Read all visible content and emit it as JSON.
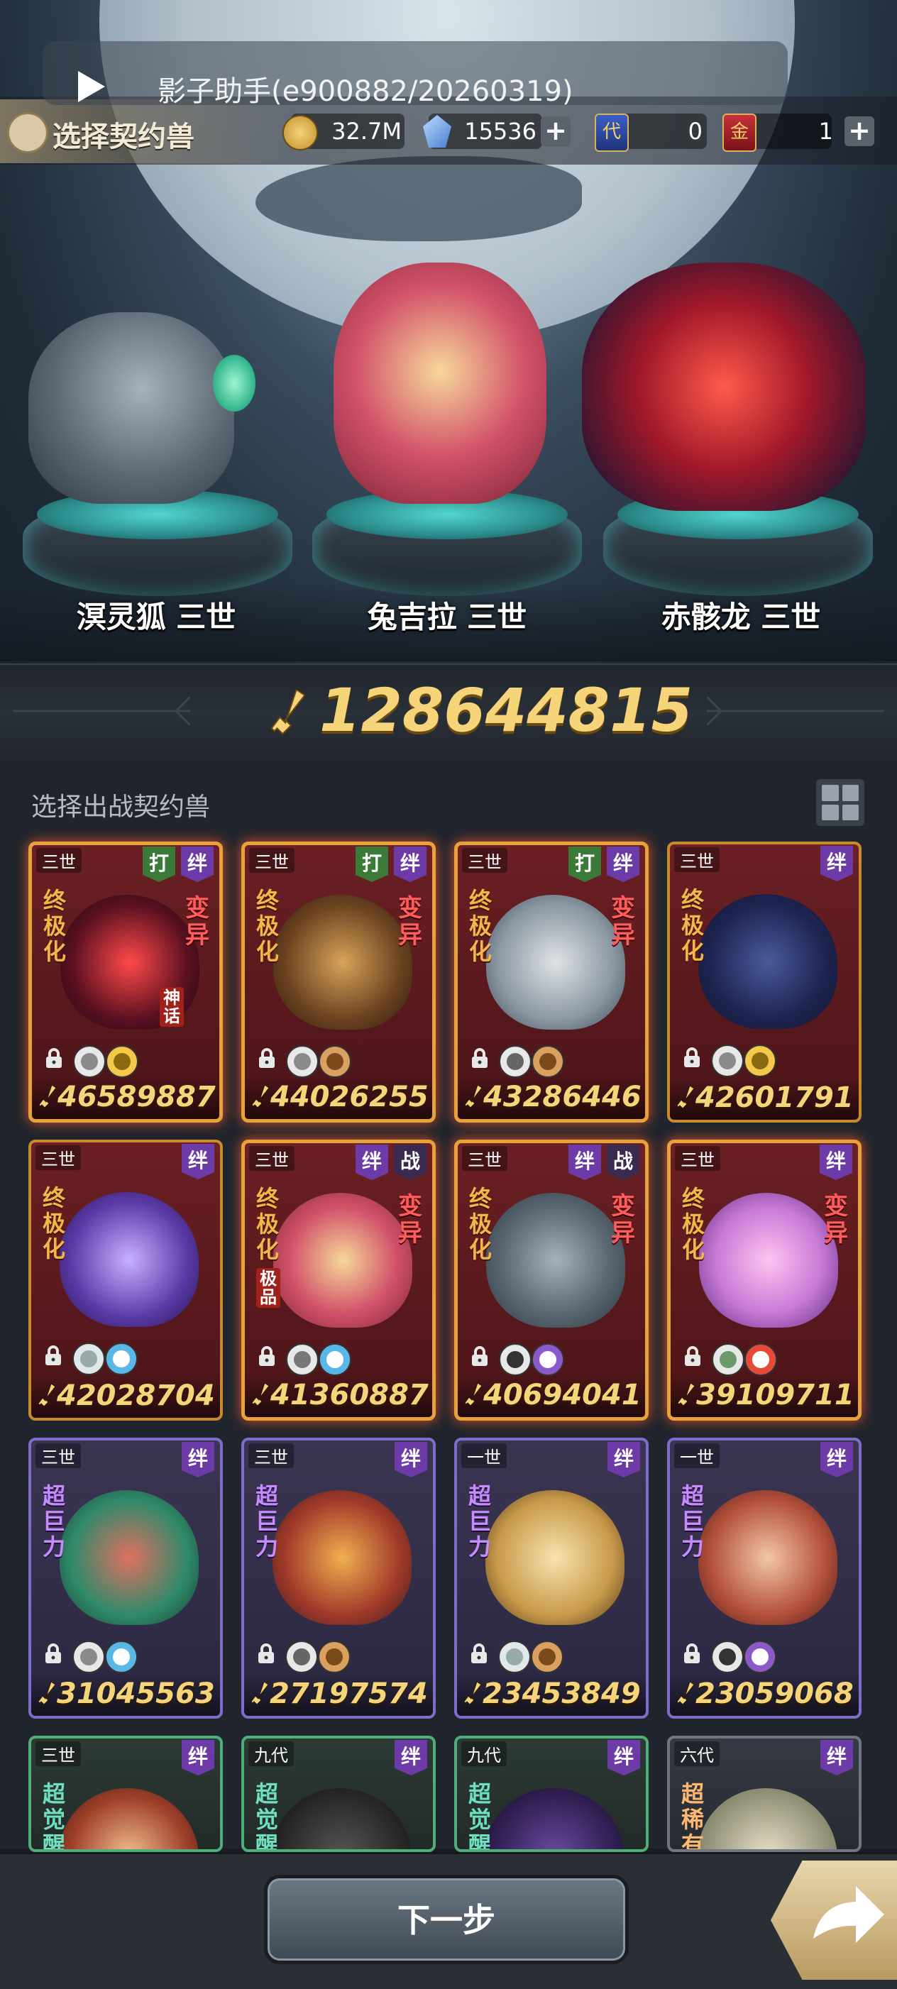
{
  "overlay": {
    "text": "影子助手(e900882/20260319)"
  },
  "header": {
    "title": "选择契约兽"
  },
  "resources": {
    "gold": "32.7M",
    "crystals": "15536",
    "ticket_a": "0",
    "ticket_b": "1",
    "ticket_a_glyph": "代",
    "ticket_b_glyph": "金"
  },
  "team": [
    {
      "name": "溟灵狐 三世"
    },
    {
      "name": "兔吉拉 三世"
    },
    {
      "name": "赤骸龙 三世"
    }
  ],
  "total_power": "128644815",
  "section_label": "选择出战契约兽",
  "next_button": "下一步",
  "cards": [
    {
      "gen": "三世",
      "tags": [
        "打",
        "绊"
      ],
      "rank": "终极化",
      "mutation": "变异",
      "extra": "神话",
      "power": "46589887",
      "style": "red",
      "elems": [
        "target",
        "star"
      ]
    },
    {
      "gen": "三世",
      "tags": [
        "打",
        "绊"
      ],
      "rank": "终极化",
      "mutation": "变异",
      "extra": "",
      "power": "44026255",
      "style": "red",
      "elems": [
        "target",
        "earth"
      ]
    },
    {
      "gen": "三世",
      "tags": [
        "打",
        "绊"
      ],
      "rank": "终极化",
      "mutation": "变异",
      "extra": "",
      "power": "43286446",
      "style": "red",
      "elems": [
        "claw",
        "earth"
      ]
    },
    {
      "gen": "三世",
      "tags": [
        "绊"
      ],
      "rank": "终极化",
      "mutation": "",
      "extra": "",
      "power": "42601791",
      "style": "redplain",
      "elems": [
        "target",
        "star"
      ]
    },
    {
      "gen": "三世",
      "tags": [
        "绊"
      ],
      "rank": "终极化",
      "mutation": "",
      "extra": "",
      "power": "42028704",
      "style": "redplain",
      "elems": [
        "leaf",
        "water"
      ]
    },
    {
      "gen": "三世",
      "tags": [
        "绊",
        "战"
      ],
      "rank": "终极化",
      "mutation": "变异",
      "extra": "极品",
      "power": "41360887",
      "style": "red",
      "elems": [
        "shield",
        "water"
      ]
    },
    {
      "gen": "三世",
      "tags": [
        "绊",
        "战"
      ],
      "rank": "终极化",
      "mutation": "变异",
      "extra": "",
      "power": "40694041",
      "style": "red",
      "elems": [
        "eye",
        "moon"
      ]
    },
    {
      "gen": "三世",
      "tags": [
        "绊"
      ],
      "rank": "终极化",
      "mutation": "变异",
      "extra": "",
      "power": "39109711",
      "style": "red",
      "elems": [
        "sprout",
        "fire"
      ]
    },
    {
      "gen": "三世",
      "tags": [
        "绊"
      ],
      "rank": "超巨力",
      "mutation": "",
      "extra": "",
      "power": "31045563",
      "style": "purple",
      "elems": [
        "target",
        "water"
      ]
    },
    {
      "gen": "三世",
      "tags": [
        "绊"
      ],
      "rank": "超巨力",
      "mutation": "",
      "extra": "",
      "power": "27197574",
      "style": "purple",
      "elems": [
        "claw",
        "earth"
      ]
    },
    {
      "gen": "一世",
      "tags": [
        "绊"
      ],
      "rank": "超巨力",
      "mutation": "",
      "extra": "",
      "power": "23453849",
      "style": "purple",
      "elems": [
        "leaf",
        "earth"
      ]
    },
    {
      "gen": "一世",
      "tags": [
        "绊"
      ],
      "rank": "超巨力",
      "mutation": "",
      "extra": "",
      "power": "23059068",
      "style": "purple",
      "elems": [
        "eye",
        "moon"
      ]
    },
    {
      "gen": "三世",
      "tags": [
        "绊"
      ],
      "rank": "超觉醒",
      "mutation": "",
      "extra": "",
      "power": "",
      "style": "green",
      "elems": []
    },
    {
      "gen": "九代",
      "tags": [
        "绊"
      ],
      "rank": "超觉醒",
      "mutation": "",
      "extra": "",
      "power": "",
      "style": "green",
      "elems": []
    },
    {
      "gen": "九代",
      "tags": [
        "绊"
      ],
      "rank": "超觉醒",
      "mutation": "",
      "extra": "",
      "power": "",
      "style": "green",
      "elems": []
    },
    {
      "gen": "六代",
      "tags": [
        "绊"
      ],
      "rank": "超稀有",
      "mutation": "",
      "extra": "",
      "power": "",
      "style": "gray",
      "elems": []
    }
  ],
  "colors": {
    "power_gold": "#f6d57a",
    "accent_red": "#e8a23a",
    "bg": "#20252d"
  }
}
